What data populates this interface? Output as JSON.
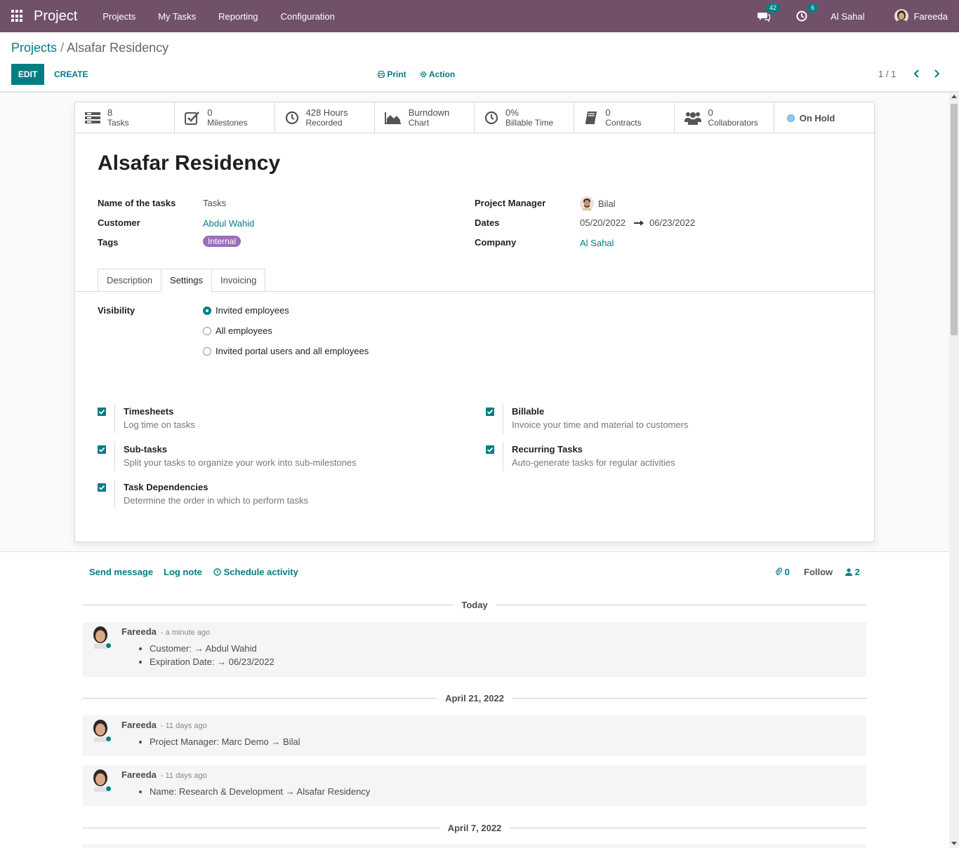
{
  "navbar": {
    "app_name": "Project",
    "menu": [
      "Projects",
      "My Tasks",
      "Reporting",
      "Configuration"
    ],
    "messages_count": "42",
    "activities_count": "6",
    "company": "Al Sahal",
    "user": "Fareeda",
    "bg_color": "#71506a"
  },
  "breadcrumb": {
    "parent": "Projects",
    "separator": "/",
    "current": "Alsafar Residency"
  },
  "control": {
    "edit": "EDIT",
    "create": "CREATE",
    "print": "Print",
    "action": "Action",
    "pager": "1 / 1"
  },
  "stats": [
    {
      "icon": "tasks-icon",
      "value": "8",
      "label": "Tasks"
    },
    {
      "icon": "check-square-icon",
      "value": "0",
      "label": "Milestones"
    },
    {
      "icon": "clock-icon",
      "value": "428 Hours",
      "label": "Recorded"
    },
    {
      "icon": "area-chart-icon",
      "value": "Burndown",
      "label": "Chart"
    },
    {
      "icon": "clock-icon",
      "value": "0%",
      "label": "Billable Time"
    },
    {
      "icon": "book-icon",
      "value": "0",
      "label": "Contracts"
    },
    {
      "icon": "users-icon",
      "value": "0",
      "label": "Collaborators"
    }
  ],
  "status": "On Hold",
  "form": {
    "title": "Alsafar Residency",
    "fields_left": [
      {
        "label": "Name of the tasks",
        "value": "Tasks"
      },
      {
        "label": "Customer",
        "value": "Abdul Wahid"
      },
      {
        "label": "Tags",
        "value": "Internal"
      }
    ],
    "fields_right": [
      {
        "label": "Project Manager",
        "value": "Bilal"
      },
      {
        "label": "Dates",
        "value_start": "05/20/2022",
        "value_end": "06/23/2022"
      },
      {
        "label": "Company",
        "value": "Al Sahal"
      }
    ],
    "tabs": [
      "Description",
      "Settings",
      "Invoicing"
    ],
    "active_tab": "Settings",
    "visibility_label": "Visibility",
    "visibility_options": [
      "Invited employees",
      "All employees",
      "Invited portal users and all employees"
    ],
    "visibility_selected": "Invited employees",
    "options": [
      {
        "title": "Timesheets",
        "desc": "Log time on tasks",
        "checked": true
      },
      {
        "title": "Billable",
        "desc": "Invoice your time and material to customers",
        "checked": true
      },
      {
        "title": "Sub-tasks",
        "desc": "Split your tasks to organize your work into sub-milestones",
        "checked": true
      },
      {
        "title": "Recurring Tasks",
        "desc": "Auto-generate tasks for regular activities",
        "checked": true
      },
      {
        "title": "Task Dependencies",
        "desc": "Determine the order in which to perform tasks",
        "checked": true
      }
    ]
  },
  "chatter": {
    "send_message": "Send message",
    "log_note": "Log note",
    "schedule_activity": "Schedule activity",
    "attachments": "0",
    "follow": "Follow",
    "followers": "2",
    "dates": [
      "Today",
      "April 21, 2022",
      "April 7, 2022"
    ],
    "messages": [
      {
        "author": "Fareeda",
        "when": "- a minute ago",
        "lines": [
          "Customer: → Abdul Wahid",
          "Expiration Date: → 06/23/2022"
        ]
      },
      {
        "author": "Fareeda",
        "when": "- 11 days ago",
        "lines": [
          "Project Manager: Marc Demo → Bilal"
        ]
      },
      {
        "author": "Fareeda",
        "when": "- 11 days ago",
        "lines": [
          "Name: Research & Development → Alsafar Residency"
        ]
      }
    ]
  },
  "colors": {
    "primary": "#017e84",
    "tag": "#9b6fb8",
    "status_dot": "#92c5f0"
  }
}
